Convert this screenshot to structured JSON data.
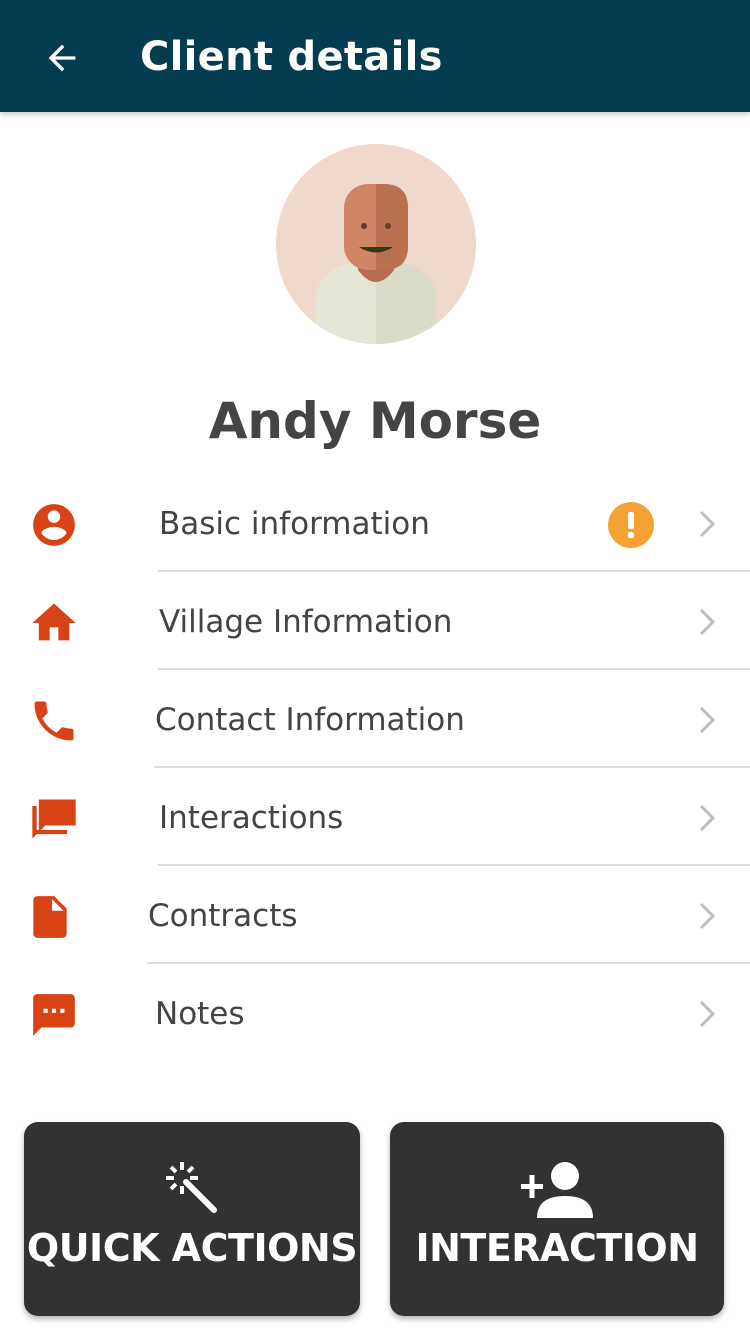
{
  "appbar": {
    "title": "Client details",
    "color": "#043c52"
  },
  "client": {
    "name": "Andy Morse"
  },
  "menu": {
    "accent_color": "#d84315",
    "items": [
      {
        "label": "Basic information",
        "icon": "account-circle-icon",
        "warning": true
      },
      {
        "label": "Village Information",
        "icon": "home-icon",
        "warning": false
      },
      {
        "label": "Contact Information",
        "icon": "phone-icon",
        "warning": false
      },
      {
        "label": "Interactions",
        "icon": "forum-icon",
        "warning": false
      },
      {
        "label": "Contracts",
        "icon": "document-icon",
        "warning": false
      },
      {
        "label": "Notes",
        "icon": "sms-icon",
        "warning": false
      }
    ],
    "warning_badge": {
      "symbol": "!",
      "color": "#f5a234"
    }
  },
  "actions": {
    "quick_actions_label": "QUICK ACTIONS",
    "interaction_label": "INTERACTION",
    "button_color": "#323232"
  }
}
